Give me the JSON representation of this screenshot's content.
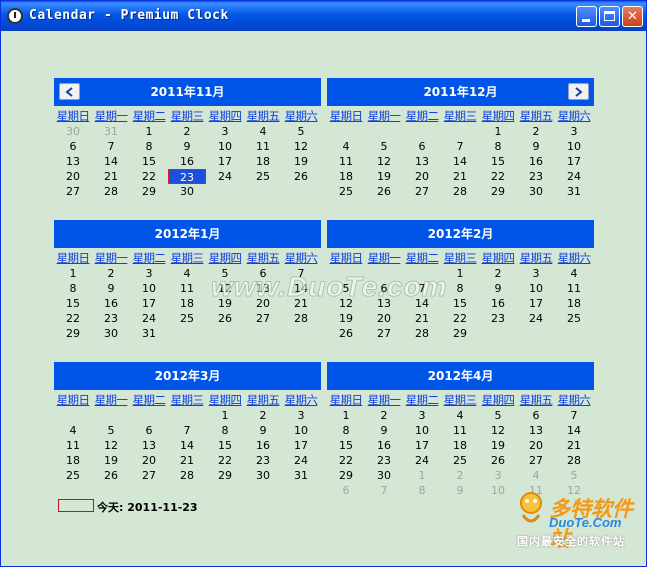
{
  "window": {
    "title": "Calendar - Premium Clock",
    "buttons": {
      "minimize": "",
      "maximize": "",
      "close": "✕"
    }
  },
  "weekdays": [
    "星期日",
    "星期一",
    "星期二",
    "星期三",
    "星期四",
    "星期五",
    "星期六"
  ],
  "months": [
    {
      "title": "2011年11月",
      "nav": "prev",
      "weeks": [
        [
          {
            "d": "30",
            "o": 1
          },
          {
            "d": "31",
            "o": 1
          },
          {
            "d": "1"
          },
          {
            "d": "2"
          },
          {
            "d": "3"
          },
          {
            "d": "4"
          },
          {
            "d": "5"
          }
        ],
        [
          {
            "d": "6"
          },
          {
            "d": "7"
          },
          {
            "d": "8"
          },
          {
            "d": "9"
          },
          {
            "d": "10"
          },
          {
            "d": "11"
          },
          {
            "d": "12"
          }
        ],
        [
          {
            "d": "13"
          },
          {
            "d": "14"
          },
          {
            "d": "15"
          },
          {
            "d": "16"
          },
          {
            "d": "17"
          },
          {
            "d": "18"
          },
          {
            "d": "19"
          }
        ],
        [
          {
            "d": "20"
          },
          {
            "d": "21"
          },
          {
            "d": "22"
          },
          {
            "d": "23",
            "t": 1
          },
          {
            "d": "24"
          },
          {
            "d": "25"
          },
          {
            "d": "26"
          }
        ],
        [
          {
            "d": "27"
          },
          {
            "d": "28"
          },
          {
            "d": "29"
          },
          {
            "d": "30"
          },
          {
            "d": ""
          },
          {
            "d": ""
          },
          {
            "d": ""
          }
        ]
      ]
    },
    {
      "title": "2011年12月",
      "nav": "next",
      "weeks": [
        [
          {
            "d": ""
          },
          {
            "d": ""
          },
          {
            "d": ""
          },
          {
            "d": ""
          },
          {
            "d": "1"
          },
          {
            "d": "2"
          },
          {
            "d": "3"
          }
        ],
        [
          {
            "d": "4"
          },
          {
            "d": "5"
          },
          {
            "d": "6"
          },
          {
            "d": "7"
          },
          {
            "d": "8"
          },
          {
            "d": "9"
          },
          {
            "d": "10"
          }
        ],
        [
          {
            "d": "11"
          },
          {
            "d": "12"
          },
          {
            "d": "13"
          },
          {
            "d": "14"
          },
          {
            "d": "15"
          },
          {
            "d": "16"
          },
          {
            "d": "17"
          }
        ],
        [
          {
            "d": "18"
          },
          {
            "d": "19"
          },
          {
            "d": "20"
          },
          {
            "d": "21"
          },
          {
            "d": "22"
          },
          {
            "d": "23"
          },
          {
            "d": "24"
          }
        ],
        [
          {
            "d": "25"
          },
          {
            "d": "26"
          },
          {
            "d": "27"
          },
          {
            "d": "28"
          },
          {
            "d": "29"
          },
          {
            "d": "30"
          },
          {
            "d": "31"
          }
        ]
      ]
    },
    {
      "title": "2012年1月",
      "weeks": [
        [
          {
            "d": "1"
          },
          {
            "d": "2"
          },
          {
            "d": "3"
          },
          {
            "d": "4"
          },
          {
            "d": "5"
          },
          {
            "d": "6"
          },
          {
            "d": "7"
          }
        ],
        [
          {
            "d": "8"
          },
          {
            "d": "9"
          },
          {
            "d": "10"
          },
          {
            "d": "11"
          },
          {
            "d": "12"
          },
          {
            "d": "13"
          },
          {
            "d": "14"
          }
        ],
        [
          {
            "d": "15"
          },
          {
            "d": "16"
          },
          {
            "d": "17"
          },
          {
            "d": "18"
          },
          {
            "d": "19"
          },
          {
            "d": "20"
          },
          {
            "d": "21"
          }
        ],
        [
          {
            "d": "22"
          },
          {
            "d": "23"
          },
          {
            "d": "24"
          },
          {
            "d": "25"
          },
          {
            "d": "26"
          },
          {
            "d": "27"
          },
          {
            "d": "28"
          }
        ],
        [
          {
            "d": "29"
          },
          {
            "d": "30"
          },
          {
            "d": "31"
          },
          {
            "d": ""
          },
          {
            "d": ""
          },
          {
            "d": ""
          },
          {
            "d": ""
          }
        ]
      ]
    },
    {
      "title": "2012年2月",
      "weeks": [
        [
          {
            "d": ""
          },
          {
            "d": ""
          },
          {
            "d": ""
          },
          {
            "d": "1"
          },
          {
            "d": "2"
          },
          {
            "d": "3"
          },
          {
            "d": "4"
          }
        ],
        [
          {
            "d": "5"
          },
          {
            "d": "6"
          },
          {
            "d": "7"
          },
          {
            "d": "8"
          },
          {
            "d": "9"
          },
          {
            "d": "10"
          },
          {
            "d": "11"
          }
        ],
        [
          {
            "d": "12"
          },
          {
            "d": "13"
          },
          {
            "d": "14"
          },
          {
            "d": "15"
          },
          {
            "d": "16"
          },
          {
            "d": "17"
          },
          {
            "d": "18"
          }
        ],
        [
          {
            "d": "19"
          },
          {
            "d": "20"
          },
          {
            "d": "21"
          },
          {
            "d": "22"
          },
          {
            "d": "23"
          },
          {
            "d": "24"
          },
          {
            "d": "25"
          }
        ],
        [
          {
            "d": "26"
          },
          {
            "d": "27"
          },
          {
            "d": "28"
          },
          {
            "d": "29"
          },
          {
            "d": ""
          },
          {
            "d": ""
          },
          {
            "d": ""
          }
        ]
      ]
    },
    {
      "title": "2012年3月",
      "weeks": [
        [
          {
            "d": ""
          },
          {
            "d": ""
          },
          {
            "d": ""
          },
          {
            "d": ""
          },
          {
            "d": "1"
          },
          {
            "d": "2"
          },
          {
            "d": "3"
          }
        ],
        [
          {
            "d": "4"
          },
          {
            "d": "5"
          },
          {
            "d": "6"
          },
          {
            "d": "7"
          },
          {
            "d": "8"
          },
          {
            "d": "9"
          },
          {
            "d": "10"
          }
        ],
        [
          {
            "d": "11"
          },
          {
            "d": "12"
          },
          {
            "d": "13"
          },
          {
            "d": "14"
          },
          {
            "d": "15"
          },
          {
            "d": "16"
          },
          {
            "d": "17"
          }
        ],
        [
          {
            "d": "18"
          },
          {
            "d": "19"
          },
          {
            "d": "20"
          },
          {
            "d": "21"
          },
          {
            "d": "22"
          },
          {
            "d": "23"
          },
          {
            "d": "24"
          }
        ],
        [
          {
            "d": "25"
          },
          {
            "d": "26"
          },
          {
            "d": "27"
          },
          {
            "d": "28"
          },
          {
            "d": "29"
          },
          {
            "d": "30"
          },
          {
            "d": "31"
          }
        ]
      ]
    },
    {
      "title": "2012年4月",
      "weeks": [
        [
          {
            "d": "1"
          },
          {
            "d": "2"
          },
          {
            "d": "3"
          },
          {
            "d": "4"
          },
          {
            "d": "5"
          },
          {
            "d": "6"
          },
          {
            "d": "7"
          }
        ],
        [
          {
            "d": "8"
          },
          {
            "d": "9"
          },
          {
            "d": "10"
          },
          {
            "d": "11"
          },
          {
            "d": "12"
          },
          {
            "d": "13"
          },
          {
            "d": "14"
          }
        ],
        [
          {
            "d": "15"
          },
          {
            "d": "16"
          },
          {
            "d": "17"
          },
          {
            "d": "18"
          },
          {
            "d": "19"
          },
          {
            "d": "20"
          },
          {
            "d": "21"
          }
        ],
        [
          {
            "d": "22"
          },
          {
            "d": "23"
          },
          {
            "d": "24"
          },
          {
            "d": "25"
          },
          {
            "d": "26"
          },
          {
            "d": "27"
          },
          {
            "d": "28"
          }
        ],
        [
          {
            "d": "29"
          },
          {
            "d": "30"
          },
          {
            "d": "1",
            "o": 1
          },
          {
            "d": "2",
            "o": 1
          },
          {
            "d": "3",
            "o": 1
          },
          {
            "d": "4",
            "o": 1
          },
          {
            "d": "5",
            "o": 1
          }
        ],
        [
          {
            "d": "6",
            "o": 1
          },
          {
            "d": "7",
            "o": 1
          },
          {
            "d": "8",
            "o": 1
          },
          {
            "d": "9",
            "o": 1
          },
          {
            "d": "10",
            "o": 1
          },
          {
            "d": "11",
            "o": 1
          },
          {
            "d": "12",
            "o": 1
          }
        ]
      ]
    }
  ],
  "today": {
    "label": "今天: 2011-11-23"
  },
  "watermarks": {
    "center": "www.DuoTe.com",
    "brand": "多特软件站",
    "site": "DuoTe.Com",
    "slogan": "国内最安全的软件站"
  },
  "colors": {
    "background": "#d4e6d4",
    "header": "#0055e8",
    "today_fill": "#1c4fdc",
    "today_border": "#e02020",
    "other_month": "#9aa89a"
  }
}
